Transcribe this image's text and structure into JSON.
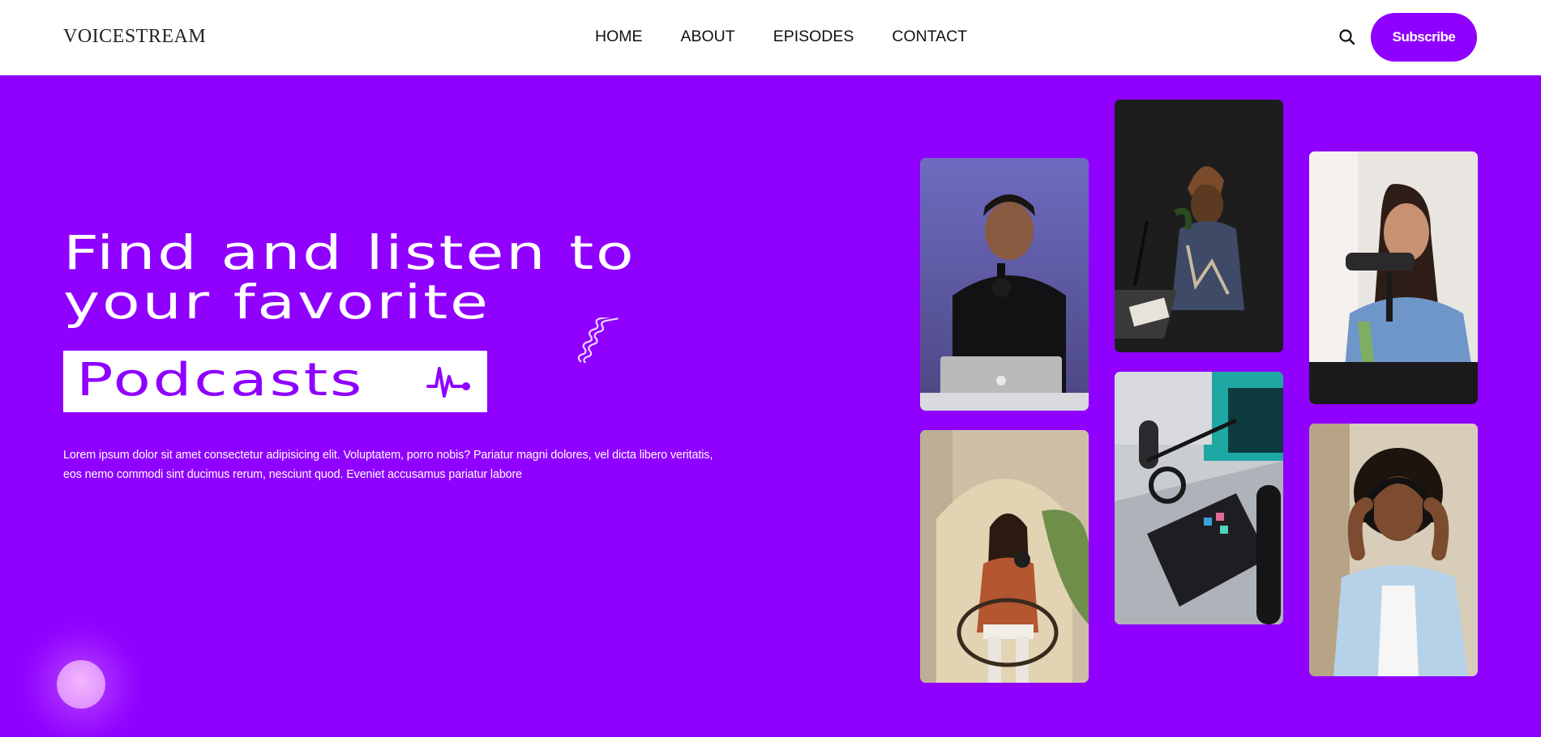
{
  "brand": {
    "logo_text": "VOICESTREAM"
  },
  "nav": {
    "items": [
      {
        "label": "HOME"
      },
      {
        "label": "ABOUT"
      },
      {
        "label": "EPISODES"
      },
      {
        "label": "CONTACT"
      }
    ],
    "search_icon": "search-icon",
    "subscribe_label": "Subscribe"
  },
  "hero": {
    "heading_line1": "Find and listen to",
    "heading_line2": "your favorite",
    "highlight": "Podcasts",
    "description": "Lorem ipsum dolor sit amet consectetur adipisicing elit. Voluptatem, porro nobis? Pariatur magni dolores, vel dicta libero veritatis, eos nemo commodi sint ducimus rerum, nesciunt quod. Eveniet accusamus pariatur labore"
  },
  "colors": {
    "accent": "#8f00ff",
    "nav_background": "#ffffff",
    "text_light": "#ffffff"
  },
  "gallery": [
    {
      "icon": "podcaster-laptop-photo"
    },
    {
      "icon": "woman-headphones-desk-photo"
    },
    {
      "icon": "woman-microphone-smiling-photo"
    },
    {
      "icon": "woman-chair-microphone-photo"
    },
    {
      "icon": "audio-mixer-photo"
    },
    {
      "icon": "woman-headphones-listening-photo"
    }
  ]
}
